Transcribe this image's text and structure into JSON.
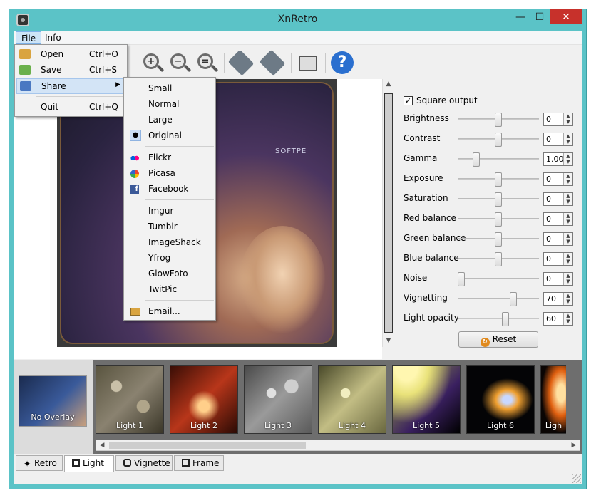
{
  "window": {
    "title": "XnRetro",
    "min_label": "—",
    "max_label": "☐",
    "close_label": "✕"
  },
  "menubar": {
    "file": "File",
    "info": "Info"
  },
  "file_menu": {
    "items": [
      {
        "label": "Open",
        "shortcut": "Ctrl+O"
      },
      {
        "label": "Save",
        "shortcut": "Ctrl+S"
      },
      {
        "label": "Share",
        "shortcut": ""
      },
      {
        "label": "Quit",
        "shortcut": "Ctrl+Q"
      }
    ]
  },
  "share_menu": {
    "sizes": [
      "Small",
      "Normal",
      "Large",
      "Original"
    ],
    "selected_size": "Original",
    "services_a": [
      "Flickr",
      "Picasa",
      "Facebook"
    ],
    "services_b": [
      "Imgur",
      "Tumblr",
      "ImageShack",
      "Yfrog",
      "GlowFoto",
      "TwitPic"
    ],
    "email": "Email..."
  },
  "toolbar": {
    "zoom_in": "+",
    "zoom_out": "−",
    "zoom_fit": "=",
    "help": "?"
  },
  "viewer": {
    "watermark": "SOFTPE"
  },
  "adjust": {
    "square_output_label": "Square output",
    "square_output_checked": true,
    "rows": [
      {
        "label": "Brightness",
        "value": "0",
        "level": 0.5
      },
      {
        "label": "Contrast",
        "value": "0",
        "level": 0.5
      },
      {
        "label": "Gamma",
        "value": "1.00",
        "level": 0.2
      },
      {
        "label": "Exposure",
        "value": "0",
        "level": 0.5
      },
      {
        "label": "Saturation",
        "value": "0",
        "level": 0.5
      },
      {
        "label": "Red balance",
        "value": "0",
        "level": 0.5
      },
      {
        "label": "Green balance",
        "value": "0",
        "level": 0.5
      },
      {
        "label": "Blue balance",
        "value": "0",
        "level": 0.5
      },
      {
        "label": "Noise",
        "value": "0",
        "level": 0.0
      },
      {
        "label": "Vignetting",
        "value": "70",
        "level": 0.7
      },
      {
        "label": "Light opacity",
        "value": "60",
        "level": 0.6
      }
    ],
    "reset_label": "Reset"
  },
  "overlays": {
    "none_label": "No Overlay",
    "items": [
      "Light 1",
      "Light 2",
      "Light 3",
      "Light 4",
      "Light 5",
      "Light 6",
      "Ligh"
    ]
  },
  "tabs": [
    "Retro",
    "Light",
    "Vignette",
    "Frame"
  ],
  "active_tab": "Light",
  "colors": {
    "titlebar": "#5bc3c7",
    "close": "#c7312b",
    "highlight": "#cde4f7"
  }
}
